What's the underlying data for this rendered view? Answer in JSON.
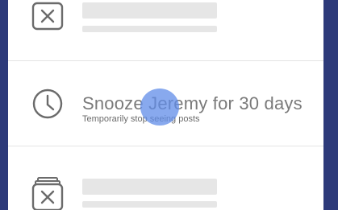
{
  "menu": {
    "items": [
      {
        "icon": "close-box-icon",
        "label": "",
        "sublabel": ""
      },
      {
        "icon": "clock-icon",
        "label": "Snooze Jeremy for 30 days",
        "sublabel": "Temporarily stop seeing posts"
      },
      {
        "icon": "unfollow-icon",
        "label": "",
        "sublabel": ""
      }
    ]
  },
  "colors": {
    "background": "#2d3a7a",
    "panel": "#ffffff",
    "icon": "#6b6b6b",
    "text": "#7a7a7a",
    "touch_indicator": "#608ce8"
  }
}
